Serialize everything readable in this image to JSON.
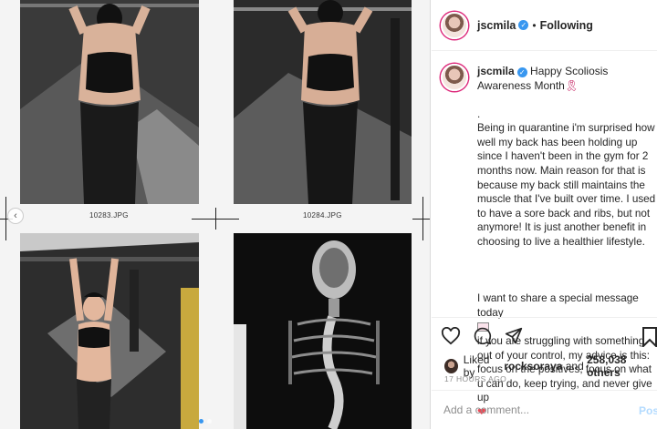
{
  "media": {
    "file_left": "10283.JPG",
    "file_right": "10284.JPG",
    "prev_glyph": "‹",
    "photos": [
      "back-view-pullup-1",
      "back-view-pullup-2",
      "front-view-pullup",
      "spine-xray"
    ]
  },
  "header": {
    "username": "jscmila",
    "separator": "•",
    "follow_state": "Following"
  },
  "caption": {
    "username": "jscmila",
    "title": "Happy Scoliosis Awareness Month",
    "p1": ".\nBeing in quarantine i'm surprised how well my back has been holding up since I haven't been in the gym for 2 months now. Main reason for that is because my back still maintains the muscle that I've built over time. I used to have a sore back and ribs, but not anymore! It is just another benefit in choosing to live a healthier lifestyle.",
    "p2a": "I want to share a special message today",
    "p2b": "if you are struggling with something out of your control, my advice is this: focus on the positives, focus on what u can do, keep trying, and never give up"
  },
  "likes": {
    "prefix": "Liked by",
    "user": "rocksoraya",
    "joiner": "and",
    "count": "258,038 others"
  },
  "timestamp": "17 HOURS AGO",
  "comment": {
    "placeholder": "Add a comment...",
    "post_label": "Post"
  },
  "colors": {
    "accent": "#3897f0",
    "heart": "#ed4956",
    "ring": "#dd2a7b"
  },
  "icons": [
    "heart-outline-icon",
    "comment-icon",
    "share-icon",
    "save-icon",
    "verified-icon"
  ]
}
